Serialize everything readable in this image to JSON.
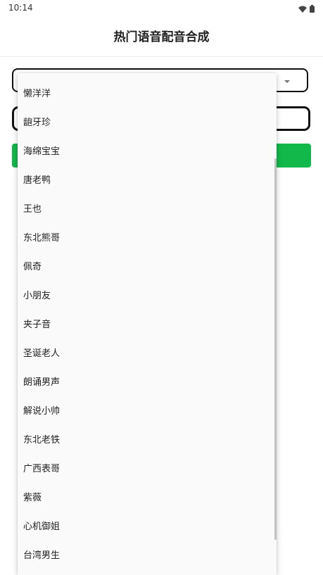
{
  "status_bar": {
    "time": "10:14",
    "icons": [
      "wifi-icon",
      "battery-icon"
    ]
  },
  "app_bar": {
    "title": "热门语音配音合成"
  },
  "form": {
    "select_value": "",
    "input_value": "",
    "button_label": ""
  },
  "dropdown": {
    "items": [
      "懒洋洋",
      "龅牙珍",
      "海绵宝宝",
      "唐老鸭",
      "王也",
      "东北熊哥",
      "佩奇",
      "小朋友",
      "夹子音",
      "圣诞老人",
      "朗诵男声",
      "解说小帅",
      "东北老铁",
      "广西表哥",
      "紫薇",
      "心机御姐",
      "台湾男生"
    ]
  },
  "colors": {
    "accent_green": "#12b84a",
    "border": "#111111",
    "dropdown_bg": "#fafafa"
  }
}
